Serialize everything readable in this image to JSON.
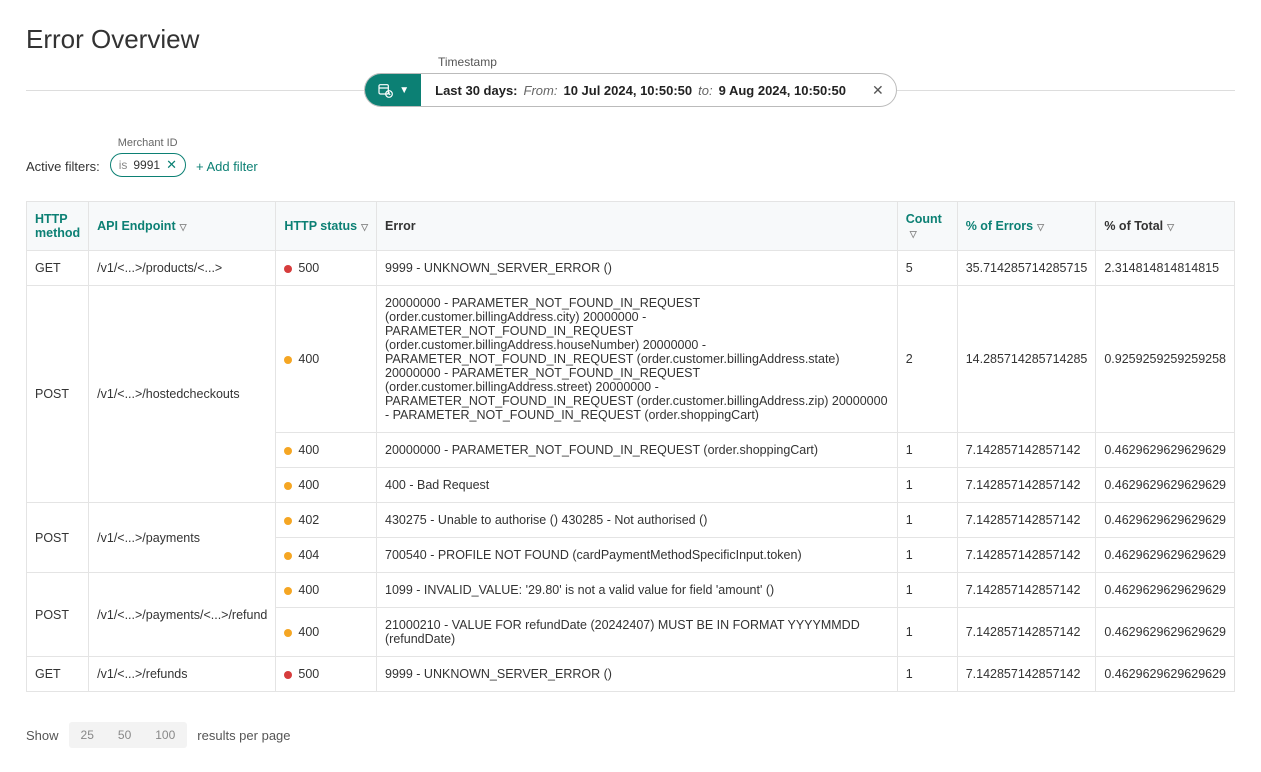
{
  "page": {
    "title": "Error Overview"
  },
  "timestamp": {
    "label": "Timestamp",
    "range_label": "Last 30 days:",
    "from_label": "From:",
    "from_value": "10 Jul 2024, 10:50:50",
    "to_label": "to:",
    "to_value": "9 Aug 2024, 10:50:50"
  },
  "filters": {
    "label": "Active filters:",
    "chip": {
      "group_label": "Merchant ID",
      "operator": "is",
      "value": "9991"
    },
    "add_label": "+ Add filter"
  },
  "columns": {
    "method": "HTTP method",
    "endpoint": "API Endpoint",
    "status": "HTTP status",
    "error": "Error",
    "count": "Count",
    "perr": "% of Errors",
    "ptotal": "% of Total"
  },
  "rows": [
    {
      "method": "GET",
      "endpoint": "/v1/<...>/products/<...>",
      "method_rowspan": 1,
      "sub": [
        {
          "status": "500",
          "dot": "red",
          "error": "9999 - UNKNOWN_SERVER_ERROR ()",
          "count": "5",
          "perr": "35.714285714285715",
          "ptotal": "2.314814814814815"
        }
      ]
    },
    {
      "method": "POST",
      "endpoint": "/v1/<...>/hostedcheckouts",
      "method_rowspan": 3,
      "sub": [
        {
          "status": "400",
          "dot": "orange",
          "error": "20000000 - PARAMETER_NOT_FOUND_IN_REQUEST (order.customer.billingAddress.city) 20000000 - PARAMETER_NOT_FOUND_IN_REQUEST (order.customer.billingAddress.houseNumber) 20000000 - PARAMETER_NOT_FOUND_IN_REQUEST (order.customer.billingAddress.state) 20000000 - PARAMETER_NOT_FOUND_IN_REQUEST (order.customer.billingAddress.street) 20000000 - PARAMETER_NOT_FOUND_IN_REQUEST (order.customer.billingAddress.zip) 20000000 - PARAMETER_NOT_FOUND_IN_REQUEST (order.shoppingCart)",
          "count": "2",
          "perr": "14.285714285714285",
          "ptotal": "0.9259259259259258"
        },
        {
          "status": "400",
          "dot": "orange",
          "error": "20000000 - PARAMETER_NOT_FOUND_IN_REQUEST (order.shoppingCart)",
          "count": "1",
          "perr": "7.142857142857142",
          "ptotal": "0.4629629629629629"
        },
        {
          "status": "400",
          "dot": "orange",
          "error": "400 - Bad Request",
          "count": "1",
          "perr": "7.142857142857142",
          "ptotal": "0.4629629629629629"
        }
      ]
    },
    {
      "method": "POST",
      "endpoint": "/v1/<...>/payments",
      "method_rowspan": 2,
      "sub": [
        {
          "status": "402",
          "dot": "orange",
          "error": "430275 - Unable to authorise () 430285 - Not authorised ()",
          "count": "1",
          "perr": "7.142857142857142",
          "ptotal": "0.4629629629629629"
        },
        {
          "status": "404",
          "dot": "orange",
          "error": "700540 - PROFILE NOT FOUND (cardPaymentMethodSpecificInput.token)",
          "count": "1",
          "perr": "7.142857142857142",
          "ptotal": "0.4629629629629629"
        }
      ]
    },
    {
      "method": "POST",
      "endpoint": "/v1/<...>/payments/<...>/refund",
      "method_rowspan": 2,
      "sub": [
        {
          "status": "400",
          "dot": "orange",
          "error": "1099 - INVALID_VALUE: '29.80' is not a valid value for field 'amount' ()",
          "count": "1",
          "perr": "7.142857142857142",
          "ptotal": "0.4629629629629629"
        },
        {
          "status": "400",
          "dot": "orange",
          "error": "21000210 - VALUE FOR refundDate (20242407) MUST BE IN FORMAT YYYYMMDD (refundDate)",
          "count": "1",
          "perr": "7.142857142857142",
          "ptotal": "0.4629629629629629"
        }
      ]
    },
    {
      "method": "GET",
      "endpoint": "/v1/<...>/refunds",
      "method_rowspan": 1,
      "sub": [
        {
          "status": "500",
          "dot": "red",
          "error": "9999 - UNKNOWN_SERVER_ERROR ()",
          "count": "1",
          "perr": "7.142857142857142",
          "ptotal": "0.4629629629629629"
        }
      ]
    }
  ],
  "pager": {
    "show": "Show",
    "opts": [
      "25",
      "50",
      "100"
    ],
    "suffix": "results per page"
  }
}
